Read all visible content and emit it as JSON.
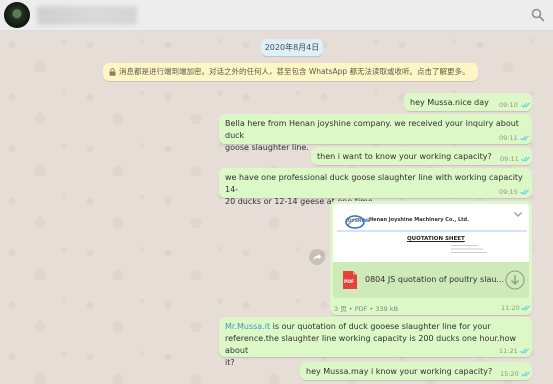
{
  "header": {
    "contact_name": "",
    "search_icon": "search-icon"
  },
  "date_chip": "2020年8月4日",
  "encryption_notice": "消息都是进行端到端加密。对话之外的任何人，甚至包含 WhatsApp 都无法读取或收听。点击了解更多。",
  "messages": [
    {
      "text": "hey Mussa.nice day",
      "time": "09:10"
    },
    {
      "line1": "Bella here from Henan joyshine company. we received your inquiry about  duck",
      "line2": "goose slaughter line.",
      "time": "09:11"
    },
    {
      "text": "then i want to know your working capacity?",
      "time": "09:11"
    },
    {
      "line1": "we have one professional duck goose slaughter line with working capacity 14-",
      "line2": "20 ducks or 12-14 geese at one time",
      "time": "09:15"
    },
    {
      "doc": {
        "company": "Henan Joyshine Machinery Co., Ltd.",
        "logo": "JOYSHINE",
        "sheet_title": "QUOTATION SHEET",
        "badge": "PDF",
        "file_name": "0804 JS quotation of poultry slau...",
        "pages": "3 页",
        "type": "PDF",
        "size": "339 kB",
        "time": "11:20"
      }
    },
    {
      "mention": "Mr.Mussa.it",
      "line1_rest": " is our quotation of duck gooese slaughter line for your",
      "line2": "reference.the slaughter line working capacity is 200 ducks one hour.how about",
      "line3": "it?",
      "time": "11:21"
    },
    {
      "text": "hey Mussa.may i know your working capacity?",
      "time": "15:20"
    }
  ],
  "colors": {
    "outgoing_bubble": "#dcf8c6",
    "read_ticks": "#4fc3f7",
    "date_chip": "#dcf0fa",
    "notice_chip": "#fff6c6",
    "pdf_badge": "#e4433b"
  }
}
